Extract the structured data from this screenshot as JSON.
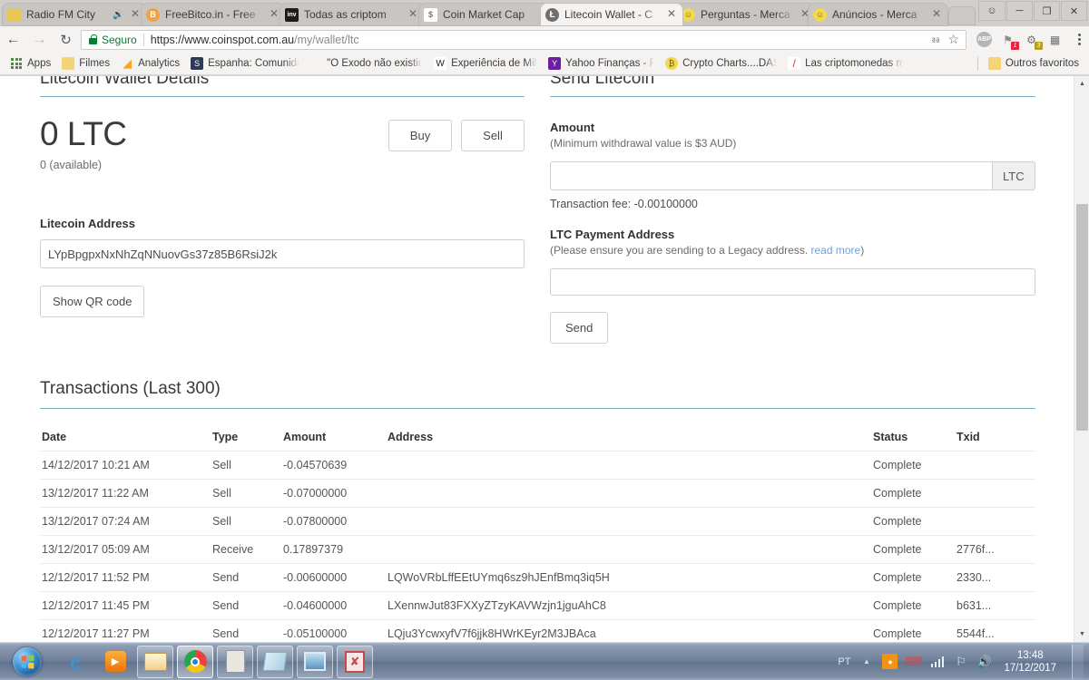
{
  "browser": {
    "tabs": [
      {
        "title": "Radio FM City",
        "favicon": "radio-icon",
        "color": "#e8c65a",
        "muted": true,
        "active": false
      },
      {
        "title": "FreeBitco.in - Free",
        "favicon": "bitcoin-icon",
        "color": "#f2a33c",
        "glyph": "B",
        "active": false
      },
      {
        "title": "Todas as criptom",
        "favicon": "investing-icon",
        "color": "#1c1c1c",
        "glyph": "inv",
        "active": false
      },
      {
        "title": "Coin Market Cap",
        "favicon": "dollar-icon",
        "color": "#ffffff",
        "glyph": "$",
        "active": false
      },
      {
        "title": "Litecoin Wallet - C",
        "favicon": "litecoin-icon",
        "color": "#5a5a5a",
        "glyph": "Ł",
        "active": true
      },
      {
        "title": "Perguntas - Merca",
        "favicon": "mercado-icon",
        "color": "#f2d94e",
        "glyph": "☺",
        "active": false
      },
      {
        "title": "Anúncios - Merca",
        "favicon": "mercado-icon",
        "color": "#f2d94e",
        "glyph": "☺",
        "active": false
      }
    ],
    "window_controls": {
      "user": "⛃",
      "minimize": "—",
      "maximize": "❐",
      "close": "✕"
    },
    "nav": {
      "back": "←",
      "forward": "→",
      "reload": "↻"
    },
    "omnibox": {
      "security_label": "Seguro",
      "url_main": "https://www.coinspot.com.au",
      "url_path": "/my/wallet/ltc",
      "full_url": "https://www.coinspot.com.au/my/wallet/ltc"
    },
    "omnibox_icons": [
      {
        "name": "translate-icon",
        "glyph": "⌨"
      },
      {
        "name": "bookmark-star-icon",
        "glyph": "☆"
      }
    ],
    "extensions": [
      {
        "name": "adblock-plus-icon",
        "glyph": "ABP",
        "badge": "",
        "badge_color": ""
      },
      {
        "name": "pinterest-save-icon",
        "glyph": "⚑",
        "badge": "1",
        "badge_color": "#e8243c"
      },
      {
        "name": "extension-icon",
        "glyph": "⚙",
        "badge": "3",
        "badge_color": "#b3a01e"
      },
      {
        "name": "qr-code-icon",
        "glyph": "▒",
        "badge": "",
        "badge_color": ""
      }
    ],
    "bookmarks": [
      {
        "label": "Apps",
        "icon": "apps-grid-icon",
        "color": "#4c8b3f",
        "glyph": ""
      },
      {
        "label": "Filmes",
        "icon": "folder-icon",
        "color": "#f4d477",
        "glyph": ""
      },
      {
        "label": "Analytics",
        "icon": "analytics-icon",
        "color": "#f5a623",
        "glyph": "◢"
      },
      {
        "label": "Espanha: Comunidad",
        "icon": "s-badge-icon",
        "color": "#2d3a56",
        "glyph": "S"
      },
      {
        "label": "\"O Êxodo não existiu",
        "icon": "blank-icon",
        "color": "transparent",
        "glyph": ""
      },
      {
        "label": "Experiência de Milgra",
        "icon": "wikipedia-icon",
        "color": "#ffffff",
        "glyph": "W"
      },
      {
        "label": "Yahoo Finanças - Fina",
        "icon": "yahoo-icon",
        "color": "#6b1f9e",
        "glyph": "Y"
      },
      {
        "label": "Crypto Charts....DASH",
        "icon": "bitcoin-icon",
        "color": "#f2d94e",
        "glyph": "₿"
      },
      {
        "label": "Las criptomonedas m",
        "icon": "slash-icon",
        "color": "#ffffff",
        "glyph": "/"
      }
    ],
    "other_bookmarks": {
      "label": "Outros favoritos",
      "icon": "folder-icon",
      "color": "#f4d477"
    }
  },
  "wallet": {
    "section_title": "Litecoin Wallet Details",
    "balance": "0 LTC",
    "available": "0 (available)",
    "buy_label": "Buy",
    "sell_label": "Sell",
    "address_label": "Litecoin Address",
    "address_value": "LYpBpgpxNxNhZqNNuovGs37z85B6RsiJ2k",
    "qr_label": "Show QR code"
  },
  "send": {
    "section_title": "Send Litecoin",
    "amount_label": "Amount",
    "amount_hint": "(Minimum withdrawal value is $3 AUD)",
    "amount_value": "",
    "amount_suffix": "LTC",
    "fee_text": "Transaction fee: -0.00100000",
    "payment_address_label": "LTC Payment Address",
    "payment_address_hint_pre": "(Please ensure you are sending to a Legacy address. ",
    "payment_address_hint_link": "read more",
    "payment_address_hint_post": ")",
    "payment_address_value": "",
    "send_label": "Send"
  },
  "transactions": {
    "title": "Transactions (Last 300)",
    "columns": [
      "Date",
      "Type",
      "Amount",
      "Address",
      "Status",
      "Txid"
    ],
    "rows": [
      {
        "date": "14/12/2017 10:21 AM",
        "type": "Sell",
        "amount": "-0.04570639",
        "address": "",
        "status": "Complete",
        "txid": ""
      },
      {
        "date": "13/12/2017 11:22 AM",
        "type": "Sell",
        "amount": "-0.07000000",
        "address": "",
        "status": "Complete",
        "txid": ""
      },
      {
        "date": "13/12/2017 07:24 AM",
        "type": "Sell",
        "amount": "-0.07800000",
        "address": "",
        "status": "Complete",
        "txid": ""
      },
      {
        "date": "13/12/2017 05:09 AM",
        "type": "Receive",
        "amount": "0.17897379",
        "address": "",
        "status": "Complete",
        "txid": "2776f..."
      },
      {
        "date": "12/12/2017 11:52 PM",
        "type": "Send",
        "amount": "-0.00600000",
        "address": "LQWoVRbLffEEtUYmq6sz9hJEnfBmq3iq5H",
        "status": "Complete",
        "txid": "2330..."
      },
      {
        "date": "12/12/2017 11:45 PM",
        "type": "Send",
        "amount": "-0.04600000",
        "address": "LXennwJut83FXXyZTzyKAVWzjn1jguAhC8",
        "status": "Complete",
        "txid": "b631..."
      },
      {
        "date": "12/12/2017 11:27 PM",
        "type": "Send",
        "amount": "-0.05100000",
        "address": "LQju3YcwxyfV7f6jjk8HWrKEyr2M3JBAca",
        "status": "Complete",
        "txid": "5544f..."
      }
    ]
  },
  "taskbar": {
    "start": "start-orb",
    "items": [
      {
        "name": "internet-explorer-icon",
        "glyph": "e",
        "boxed": false
      },
      {
        "name": "media-player-icon",
        "glyph": "▶",
        "boxed": false
      },
      {
        "name": "file-explorer-icon",
        "glyph": "▤",
        "boxed": true
      },
      {
        "name": "google-chrome-icon",
        "glyph": "",
        "boxed": true,
        "active": true
      },
      {
        "name": "calculator-icon",
        "glyph": "▦",
        "boxed": true
      },
      {
        "name": "notepad-icon",
        "glyph": "▱",
        "boxed": true
      },
      {
        "name": "photo-viewer-icon",
        "glyph": "⛰",
        "boxed": true
      },
      {
        "name": "image-editor-icon",
        "glyph": "✗",
        "boxed": true
      }
    ],
    "tray": {
      "language": "PT",
      "overflow": "▲",
      "icons": [
        {
          "name": "antivirus-icon",
          "glyph": "◆",
          "color": "#f39314"
        },
        {
          "name": "printer-icon",
          "glyph": "⎙",
          "color": "#cf3030"
        },
        {
          "name": "network-signal-icon",
          "glyph": "",
          "color": "#e8eef6"
        },
        {
          "name": "action-center-icon",
          "glyph": "⚑",
          "color": "#e2e8f2"
        },
        {
          "name": "volume-icon",
          "glyph": "🔊",
          "color": "#e2e8f2"
        }
      ],
      "time": "13:48",
      "date": "17/12/2017"
    }
  },
  "colors": {
    "accent_rule": "#7fb3c8",
    "secure_green": "#0a7d33",
    "link_blue": "#6f9fd8"
  }
}
